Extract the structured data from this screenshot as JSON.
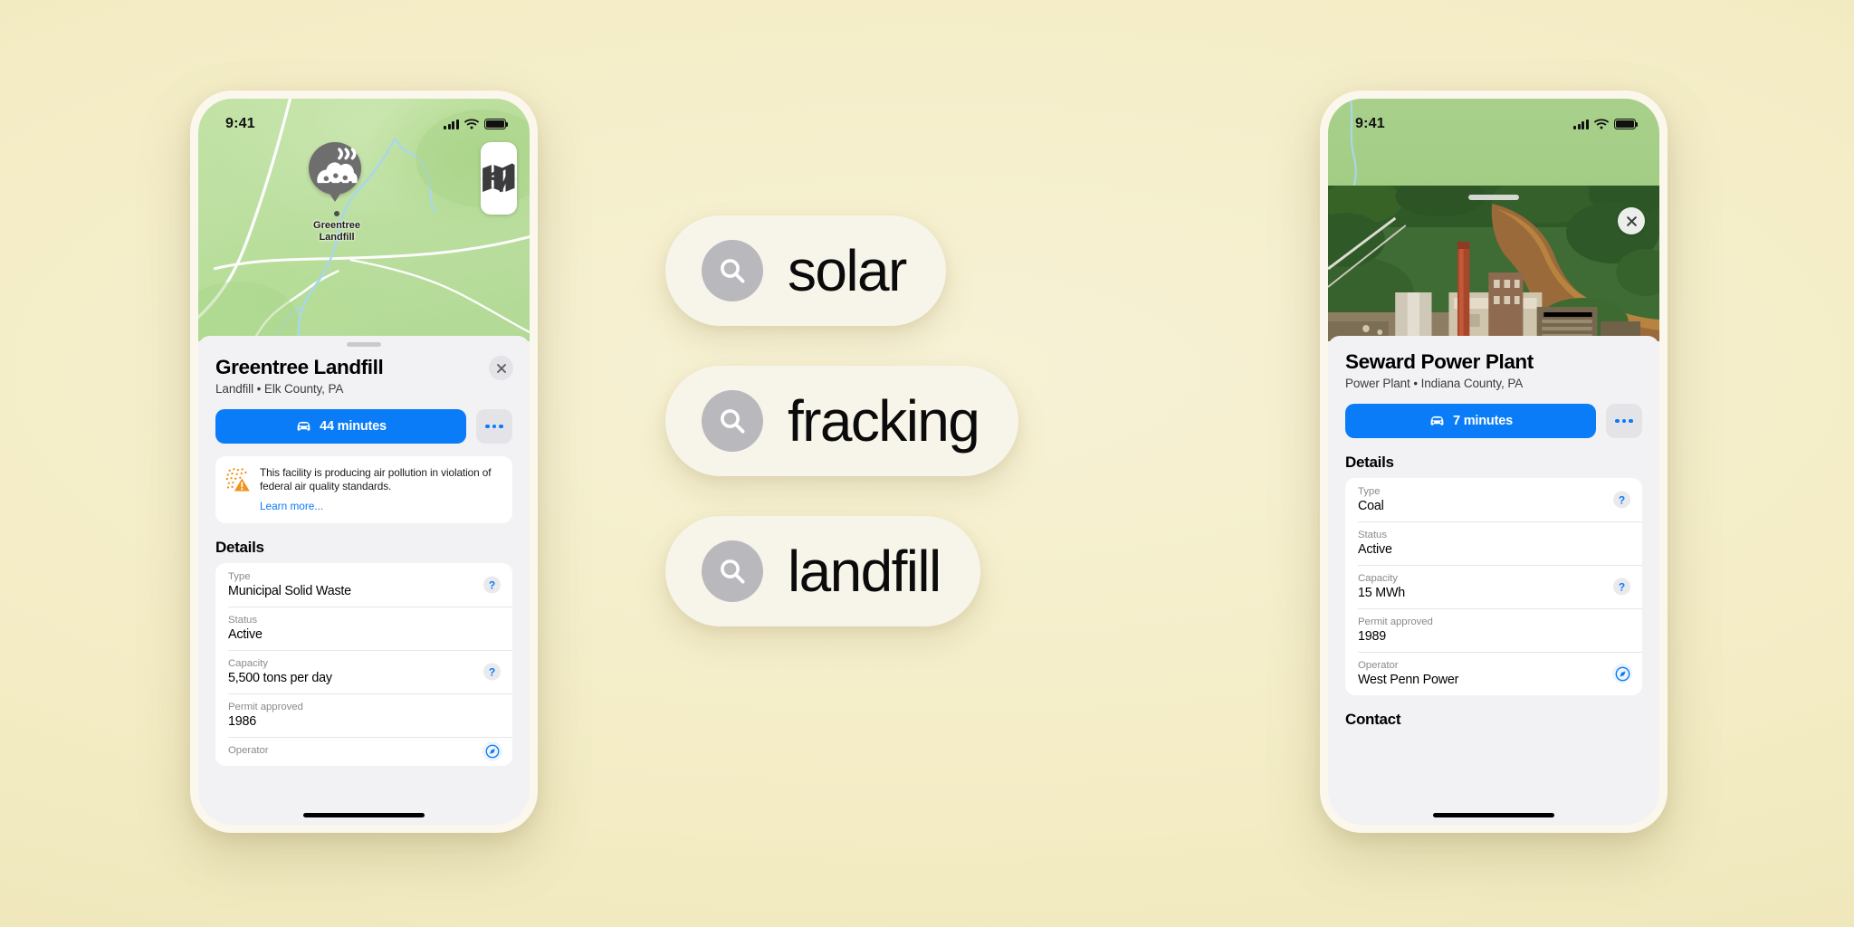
{
  "status_bar": {
    "time": "9:41",
    "signal_icon": "cellular-signal-icon",
    "wifi_icon": "wifi-icon",
    "battery_icon": "battery-icon"
  },
  "search_pills": [
    {
      "query": "solar",
      "icon": "search-icon"
    },
    {
      "query": "fracking",
      "icon": "search-icon"
    },
    {
      "query": "landfill",
      "icon": "search-icon"
    }
  ],
  "left_phone": {
    "map": {
      "pin_label_line1": "Greentree",
      "pin_label_line2": "Landfill",
      "pin_icon": "landfill-pin-icon",
      "controls": [
        {
          "name": "map-layers-button",
          "icon": "map-layers-icon"
        },
        {
          "name": "locate-me-button",
          "icon": "location-arrow-icon"
        }
      ]
    },
    "place": {
      "title": "Greentree Landfill",
      "subtitle": "Landfill • Elk County, PA",
      "close_icon": "close-icon",
      "route_button": {
        "label": "44 minutes",
        "icon": "car-icon"
      },
      "more_button": {
        "name": "more-options-button",
        "icon": "ellipsis-icon"
      }
    },
    "warning": {
      "icon": "air-pollution-warning-icon",
      "text": "This facility is producing air pollution in violation of federal air quality standards.",
      "link": "Learn more..."
    },
    "details_heading": "Details",
    "details": [
      {
        "label": "Type",
        "value": "Municipal Solid Waste",
        "accessory": "help-icon"
      },
      {
        "label": "Status",
        "value": "Active",
        "accessory": ""
      },
      {
        "label": "Capacity",
        "value": "5,500 tons per day",
        "accessory": "help-icon"
      },
      {
        "label": "Permit approved",
        "value": "1986",
        "accessory": ""
      },
      {
        "label": "Operator",
        "value": "",
        "accessory": "compass-icon"
      }
    ]
  },
  "right_phone": {
    "photo": {
      "name": "aerial-photo-power-plant",
      "alt_icon": "power-plant-photo"
    },
    "close_icon": "close-icon",
    "place": {
      "title": "Seward Power Plant",
      "subtitle": "Power Plant • Indiana County, PA",
      "route_button": {
        "label": "7 minutes",
        "icon": "car-icon"
      },
      "more_button": {
        "name": "more-options-button",
        "icon": "ellipsis-icon"
      }
    },
    "details_heading": "Details",
    "details": [
      {
        "label": "Type",
        "value": "Coal",
        "accessory": "help-icon"
      },
      {
        "label": "Status",
        "value": "Active",
        "accessory": ""
      },
      {
        "label": "Capacity",
        "value": "15 MWh",
        "accessory": "help-icon"
      },
      {
        "label": "Permit approved",
        "value": "1989",
        "accessory": ""
      },
      {
        "label": "Operator",
        "value": "West Penn Power",
        "accessory": "compass-icon"
      }
    ],
    "contact_heading": "Contact"
  },
  "colors": {
    "accent_blue": "#0a7cf7",
    "warning_orange": "#f08a1e",
    "background": "#f3ecc4",
    "pill_background": "#f7f4e9"
  }
}
